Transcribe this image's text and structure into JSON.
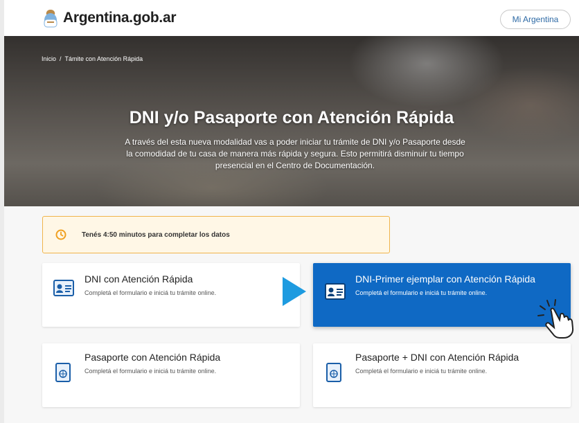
{
  "header": {
    "logo_text": "Argentina.gob.ar",
    "account_button": "Mi Argentina"
  },
  "breadcrumb": {
    "home": "Inicio",
    "separator": "/",
    "current": "Támite con Atención Rápida"
  },
  "hero": {
    "title": "DNI y/o Pasaporte con Atención Rápida",
    "description": "A través del esta nueva modalidad vas a poder iniciar tu trámite de DNI y/o Pasaporte desde la comodidad de tu casa de manera más rápida y segura. Esto permitirá disminuir tu tiempo presencial en el Centro de Documentación."
  },
  "timer": {
    "text": "Tenés 4:50 minutos para completar los datos"
  },
  "cards": [
    {
      "title": "DNI con Atención Rápida",
      "subtitle": "Completá el formulario e iniciá tu trámite online.",
      "icon": "id-card-icon"
    },
    {
      "title": "DNI-Primer ejemplar con Atención Rápida",
      "subtitle": "Completá el formulario e iniciá tu trámite online.",
      "icon": "id-card-icon",
      "selected": true
    },
    {
      "title": "Pasaporte con Atención Rápida",
      "subtitle": "Completá el formulario e iniciá tu trámite online.",
      "icon": "passport-icon"
    },
    {
      "title": "Pasaporte + DNI con Atención Rápida",
      "subtitle": "Completá el formulario e iniciá tu trámite online.",
      "icon": "passport-icon"
    }
  ],
  "colors": {
    "accent_blue": "#0f69c4",
    "link_blue": "#2e6aa5",
    "timer_border": "#f0b44a",
    "timer_bg": "#fff7e6"
  }
}
